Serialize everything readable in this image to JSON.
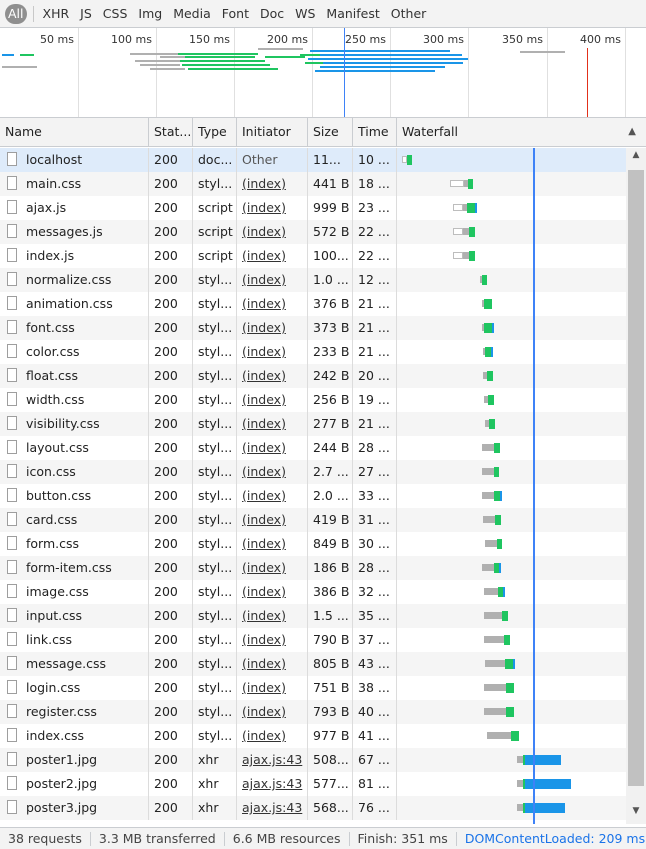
{
  "filters": [
    "All",
    "XHR",
    "JS",
    "CSS",
    "Img",
    "Media",
    "Font",
    "Doc",
    "WS",
    "Manifest",
    "Other"
  ],
  "active_filter": "All",
  "overview": {
    "ticks": [
      "50 ms",
      "100 ms",
      "150 ms",
      "200 ms",
      "250 ms",
      "300 ms",
      "350 ms",
      "400 ms"
    ]
  },
  "columns": {
    "name": "Name",
    "status": "Stat...",
    "type": "Type",
    "initiator": "Initiator",
    "size": "Size",
    "time": "Time",
    "waterfall": "Waterfall"
  },
  "rows": [
    {
      "name": "localhost",
      "status": "200",
      "type": "doc...",
      "initiator": "Other",
      "size": "11...",
      "time": "10 ..."
    },
    {
      "name": "main.css",
      "status": "200",
      "type": "styl...",
      "initiator": "(index)",
      "size": "441 B",
      "time": "18 ..."
    },
    {
      "name": "ajax.js",
      "status": "200",
      "type": "script",
      "initiator": "(index)",
      "size": "999 B",
      "time": "23 ..."
    },
    {
      "name": "messages.js",
      "status": "200",
      "type": "script",
      "initiator": "(index)",
      "size": "572 B",
      "time": "22 ..."
    },
    {
      "name": "index.js",
      "status": "200",
      "type": "script",
      "initiator": "(index)",
      "size": "100...",
      "time": "22 ..."
    },
    {
      "name": "normalize.css",
      "status": "200",
      "type": "styl...",
      "initiator": "(index)",
      "size": "1.0 ...",
      "time": "12 ..."
    },
    {
      "name": "animation.css",
      "status": "200",
      "type": "styl...",
      "initiator": "(index)",
      "size": "376 B",
      "time": "21 ..."
    },
    {
      "name": "font.css",
      "status": "200",
      "type": "styl...",
      "initiator": "(index)",
      "size": "373 B",
      "time": "21 ..."
    },
    {
      "name": "color.css",
      "status": "200",
      "type": "styl...",
      "initiator": "(index)",
      "size": "233 B",
      "time": "21 ..."
    },
    {
      "name": "float.css",
      "status": "200",
      "type": "styl...",
      "initiator": "(index)",
      "size": "242 B",
      "time": "20 ..."
    },
    {
      "name": "width.css",
      "status": "200",
      "type": "styl...",
      "initiator": "(index)",
      "size": "256 B",
      "time": "19 ..."
    },
    {
      "name": "visibility.css",
      "status": "200",
      "type": "styl...",
      "initiator": "(index)",
      "size": "277 B",
      "time": "21 ..."
    },
    {
      "name": "layout.css",
      "status": "200",
      "type": "styl...",
      "initiator": "(index)",
      "size": "244 B",
      "time": "28 ..."
    },
    {
      "name": "icon.css",
      "status": "200",
      "type": "styl...",
      "initiator": "(index)",
      "size": "2.7 ...",
      "time": "27 ..."
    },
    {
      "name": "button.css",
      "status": "200",
      "type": "styl...",
      "initiator": "(index)",
      "size": "2.0 ...",
      "time": "33 ..."
    },
    {
      "name": "card.css",
      "status": "200",
      "type": "styl...",
      "initiator": "(index)",
      "size": "419 B",
      "time": "31 ..."
    },
    {
      "name": "form.css",
      "status": "200",
      "type": "styl...",
      "initiator": "(index)",
      "size": "849 B",
      "time": "30 ..."
    },
    {
      "name": "form-item.css",
      "status": "200",
      "type": "styl...",
      "initiator": "(index)",
      "size": "186 B",
      "time": "28 ..."
    },
    {
      "name": "image.css",
      "status": "200",
      "type": "styl...",
      "initiator": "(index)",
      "size": "386 B",
      "time": "32 ..."
    },
    {
      "name": "input.css",
      "status": "200",
      "type": "styl...",
      "initiator": "(index)",
      "size": "1.5 ...",
      "time": "35 ..."
    },
    {
      "name": "link.css",
      "status": "200",
      "type": "styl...",
      "initiator": "(index)",
      "size": "790 B",
      "time": "37 ..."
    },
    {
      "name": "message.css",
      "status": "200",
      "type": "styl...",
      "initiator": "(index)",
      "size": "805 B",
      "time": "43 ..."
    },
    {
      "name": "login.css",
      "status": "200",
      "type": "styl...",
      "initiator": "(index)",
      "size": "751 B",
      "time": "38 ..."
    },
    {
      "name": "register.css",
      "status": "200",
      "type": "styl...",
      "initiator": "(index)",
      "size": "793 B",
      "time": "40 ..."
    },
    {
      "name": "index.css",
      "status": "200",
      "type": "styl...",
      "initiator": "(index)",
      "size": "977 B",
      "time": "41 ..."
    },
    {
      "name": "poster1.jpg",
      "status": "200",
      "type": "xhr",
      "initiator": "ajax.js:43",
      "size": "508...",
      "time": "67 ..."
    },
    {
      "name": "poster2.jpg",
      "status": "200",
      "type": "xhr",
      "initiator": "ajax.js:43",
      "size": "577...",
      "time": "81 ..."
    },
    {
      "name": "poster3.jpg",
      "status": "200",
      "type": "xhr",
      "initiator": "ajax.js:43",
      "size": "568...",
      "time": "76 ..."
    }
  ],
  "status": {
    "requests": "38 requests",
    "transferred": "3.3 MB transferred",
    "resources": "6.6 MB resources",
    "finish": "Finish: 351 ms",
    "dcl": "DOMContentLoaded: 209 ms"
  },
  "colors": {
    "waiting": "#1fc560",
    "download": "#1a95e8",
    "dcl_line": "#3e82f7",
    "load_line": "#e2301a"
  }
}
